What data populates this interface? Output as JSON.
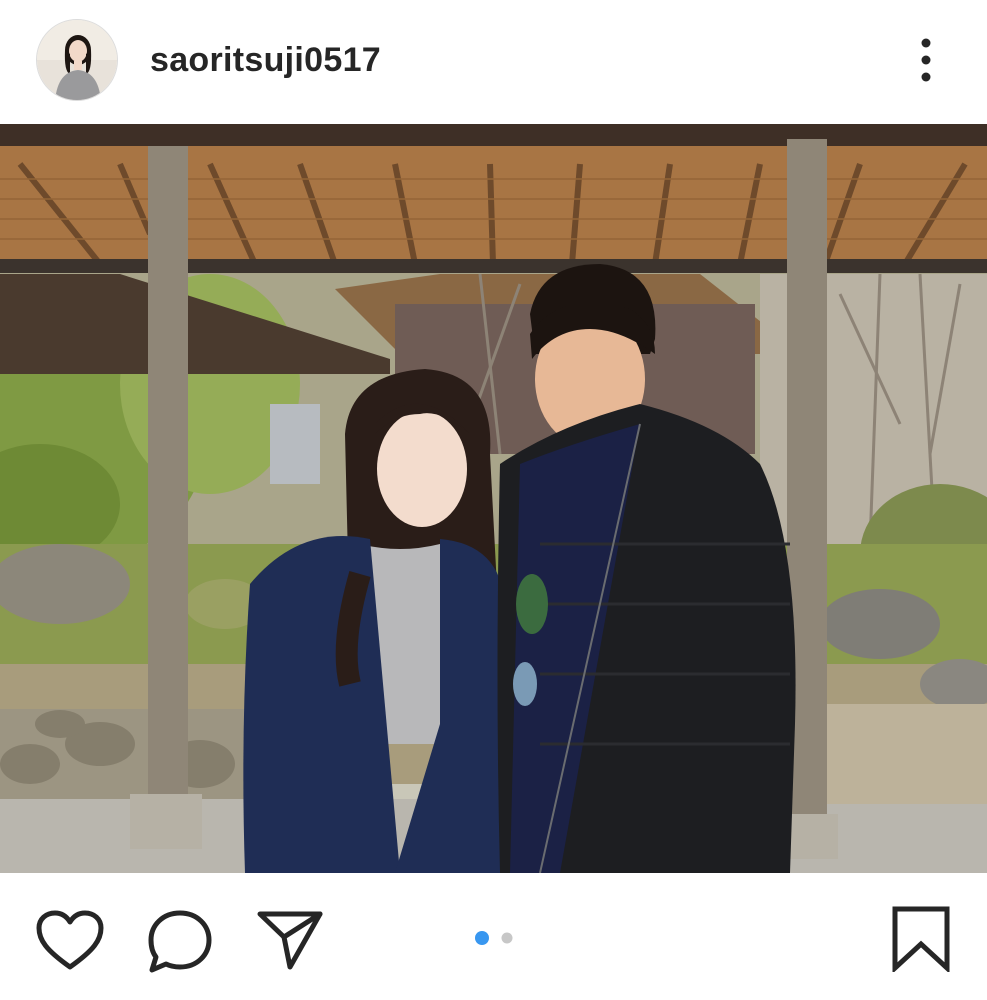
{
  "post": {
    "username": "saoritsuji0517",
    "avatar_icon": "profile-photo-avatar",
    "more_icon": "more-options-icon",
    "photo_description_icon": "post-photo",
    "carousel": {
      "total": 2,
      "current": 1,
      "active_color": "#3897f0",
      "inactive_color": "#c7c7c7"
    }
  },
  "actions": {
    "like_icon": "heart-icon",
    "comment_icon": "comment-icon",
    "share_icon": "send-icon",
    "save_icon": "bookmark-icon"
  },
  "colors": {
    "text": "#262626",
    "background": "#ffffff"
  }
}
